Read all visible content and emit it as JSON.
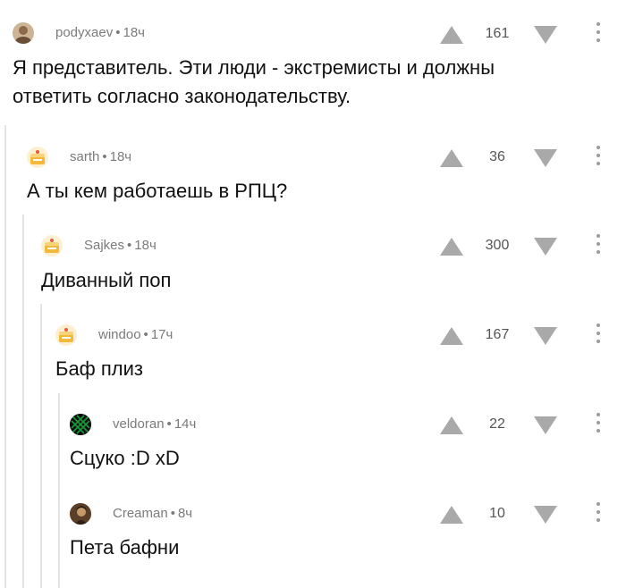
{
  "comments": [
    {
      "author": "podyxaev",
      "time": "18ч",
      "rating": "161",
      "text": "Я представитель. Эти люди - экстремисты и должны ответить согласно законодательству.",
      "avatar": "photo",
      "avatar_color": "#a98a6a"
    },
    {
      "author": "sarth",
      "time": "18ч",
      "rating": "36",
      "text": "А ты кем работаешь в РПЦ?",
      "avatar": "default-cake",
      "avatar_color": "#f3b93a"
    },
    {
      "author": "Sajkes",
      "time": "18ч",
      "rating": "300",
      "text": "Диванный поп",
      "avatar": "default-cake",
      "avatar_color": "#f3b93a"
    },
    {
      "author": "windoo",
      "time": "17ч",
      "rating": "167",
      "text": "Баф плиз",
      "avatar": "default-cake",
      "avatar_color": "#f3b93a"
    },
    {
      "author": "veldoran",
      "time": "14ч",
      "rating": "22",
      "text": "Сцуко :D xD",
      "avatar": "cross-pattern",
      "avatar_color": "#1a9a3a"
    },
    {
      "author": "Creaman",
      "time": "8ч",
      "rating": "10",
      "text": "Пета бафни",
      "avatar": "photo",
      "avatar_color": "#7a5a3a"
    }
  ],
  "icons": {
    "upvote": "triangle-up-icon",
    "downvote": "triangle-down-icon",
    "more": "more-vertical-icon"
  },
  "colors": {
    "meta": "#7b7b7b",
    "arrow": "#a9a9a9",
    "thread_line": "#e4e4e4"
  }
}
